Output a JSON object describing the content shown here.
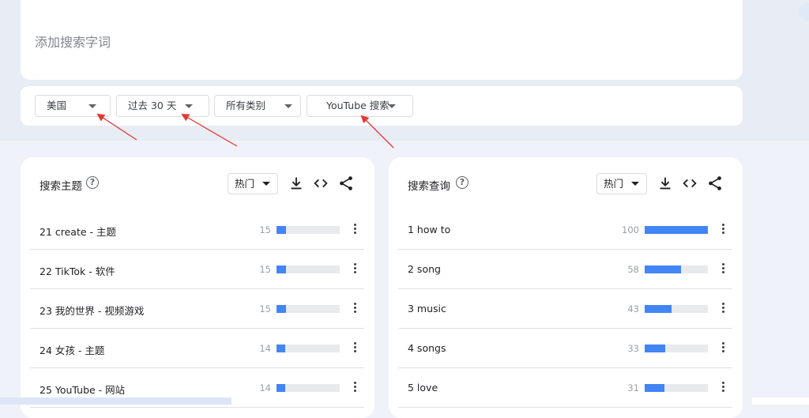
{
  "search": {
    "placeholder": "添加搜索字词"
  },
  "filters": [
    {
      "label": "美国"
    },
    {
      "label": "过去 30 天"
    },
    {
      "label": "所有类别"
    },
    {
      "label": "YouTube 搜索"
    }
  ],
  "cards": [
    {
      "title": "搜索主题",
      "sort_label": "热门",
      "rows": [
        {
          "label": "21 create - 主题",
          "value": "15",
          "fraction": 0.15
        },
        {
          "label": "22 TikTok - 软件",
          "value": "15",
          "fraction": 0.15
        },
        {
          "label": "23 我的世界 - 视频游戏",
          "value": "15",
          "fraction": 0.15
        },
        {
          "label": "24 女孩 - 主题",
          "value": "14",
          "fraction": 0.14
        },
        {
          "label": "25 YouTube - 网站",
          "value": "14",
          "fraction": 0.14
        }
      ]
    },
    {
      "title": "搜索查询",
      "sort_label": "热门",
      "rows": [
        {
          "label": "1   how to",
          "value": "100",
          "fraction": 1.0
        },
        {
          "label": "2   song",
          "value": "58",
          "fraction": 0.58
        },
        {
          "label": "3   music",
          "value": "43",
          "fraction": 0.43
        },
        {
          "label": "4   songs",
          "value": "33",
          "fraction": 0.33
        },
        {
          "label": "5   love",
          "value": "31",
          "fraction": 0.31
        }
      ]
    }
  ],
  "colors": {
    "bar": "#4285f4",
    "annotation_arrow": "#e53935"
  },
  "icons": [
    "download-icon",
    "embed-icon",
    "share-icon",
    "help-icon",
    "more-vert-icon"
  ]
}
